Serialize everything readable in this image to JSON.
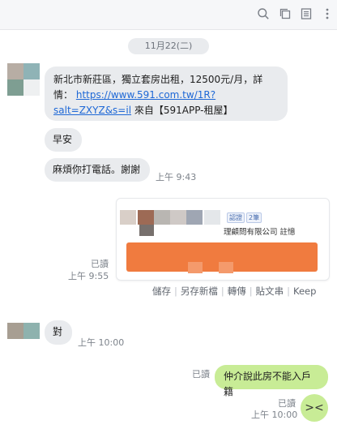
{
  "toolbar": {
    "icons": [
      "search-icon",
      "copy-icon",
      "note-icon",
      "more-icon"
    ]
  },
  "date_divider": "11月22(二)",
  "messages": {
    "m1": {
      "line1": "新北市新莊區，獨立套房出租，12500元/月，詳",
      "line2_prefix": "情：",
      "link_part1": "https://www.591.com.tw/1R?",
      "link_part2": "salt=ZXYZ&s=il",
      "line3_suffix": "來自【591APP-租屋】"
    },
    "m2": {
      "text": "早安"
    },
    "m3": {
      "text": "麻煩你打電話。謝謝",
      "time": "上午 9:43"
    },
    "card": {
      "tag1": "認證",
      "tag2": "2筆",
      "company": "理顧問有限公司 註憶",
      "read": "已讀",
      "time": "上午 9:55",
      "actions": [
        "儲存",
        "另存新檔",
        "轉傳",
        "貼文串",
        "Keep"
      ]
    },
    "m4": {
      "text": "對",
      "time": "上午 10:00"
    },
    "m5": {
      "text": "仲介說此房不能入戶籍",
      "read": "已讀"
    },
    "m6": {
      "sticker": "><",
      "read": "已讀",
      "time": "上午 10:00"
    }
  },
  "colors": {
    "incoming_bubble": "#e9ebee",
    "outgoing_bubble": "#c8ec96",
    "link": "#1e68d6",
    "card_button": "#f07b3f"
  }
}
